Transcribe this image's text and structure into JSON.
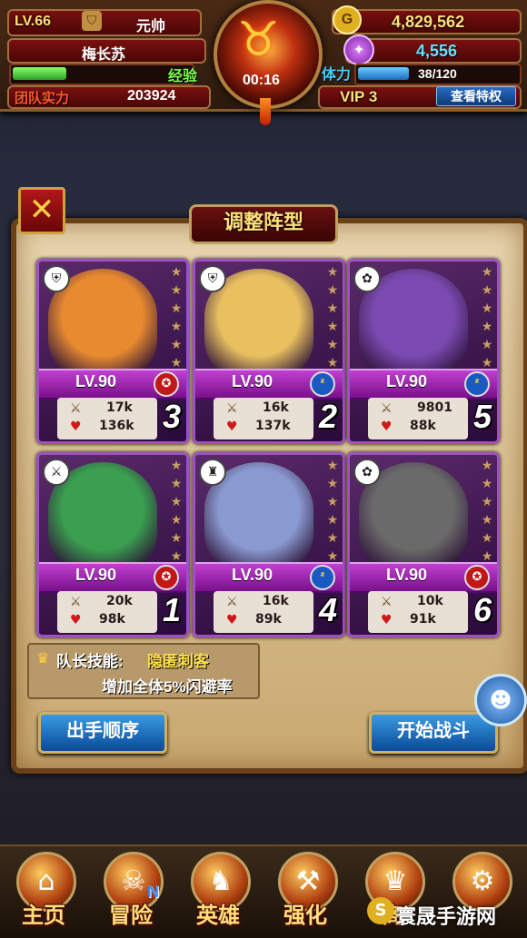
{
  "hud": {
    "level": "LV.66",
    "rank": "元帅",
    "player_name": "梅长苏",
    "exp_label": "经验",
    "exp_fill": 0.3,
    "power_label": "团队实力",
    "power_value": "203924",
    "timer": "00:16",
    "gold": "4,829,562",
    "gold_icon": "G",
    "gems": "4,556",
    "stamina_label": "体力",
    "stamina": "38/120",
    "stamina_fill": 0.3167,
    "vip": "VIP  3",
    "vip_button": "查看特权"
  },
  "panel": {
    "title": "调整阵型",
    "close": "✕"
  },
  "heroes": [
    {
      "class_icon": "shield-icon",
      "class_glyph": "⛨",
      "level": "LV.90",
      "faction": "red",
      "faction_glyph": "✪",
      "attack": "17k",
      "hp": "136k",
      "slot": "3",
      "color": "#e88a30"
    },
    {
      "class_icon": "shield-icon",
      "class_glyph": "⛨",
      "level": "LV.90",
      "faction": "blue",
      "faction_glyph": "ᶻ",
      "attack": "16k",
      "hp": "137k",
      "slot": "2",
      "color": "#e8c060"
    },
    {
      "class_icon": "paw-icon",
      "class_glyph": "✿",
      "level": "LV.90",
      "faction": "blue",
      "faction_glyph": "ᶻ",
      "attack": "9801",
      "hp": "88k",
      "slot": "5",
      "color": "#7a4ab0"
    },
    {
      "class_icon": "swords-icon",
      "class_glyph": "⚔",
      "level": "LV.90",
      "faction": "red",
      "faction_glyph": "✪",
      "attack": "20k",
      "hp": "98k",
      "slot": "1",
      "color": "#3aa050"
    },
    {
      "class_icon": "helmet-icon",
      "class_glyph": "♜",
      "level": "LV.90",
      "faction": "blue",
      "faction_glyph": "ᶻ",
      "attack": "16k",
      "hp": "89k",
      "slot": "4",
      "color": "#8a9ad0"
    },
    {
      "class_icon": "paw-icon",
      "class_glyph": "✿",
      "level": "LV.90",
      "faction": "red",
      "faction_glyph": "✪",
      "attack": "10k",
      "hp": "91k",
      "slot": "6",
      "color": "#6a6a6a"
    }
  ],
  "leader_skill": {
    "label": "队长技能:",
    "name": "隐匿刺客",
    "desc": "增加全体5%闪避率"
  },
  "buttons": {
    "order": "出手顺序",
    "start": "开始战斗"
  },
  "nav": [
    {
      "label": "主页",
      "icon": "home-icon",
      "glyph": "⌂"
    },
    {
      "label": "冒险",
      "icon": "skull-icon",
      "glyph": "☠",
      "badge": "N"
    },
    {
      "label": "英雄",
      "icon": "helmet-icon",
      "glyph": "♞"
    },
    {
      "label": "强化",
      "icon": "hammer-icon",
      "glyph": "⚒"
    },
    {
      "label": "商",
      "icon": "crown-icon",
      "glyph": "♛"
    },
    {
      "label": "",
      "icon": "gear-icon",
      "glyph": "⚙"
    }
  ],
  "watermark": {
    "text": "寰晟手游网",
    "logo": "S"
  },
  "colors": {
    "gold_text": "#ffe07a",
    "exp_green": "#4ad04a",
    "stamina_blue": "#3a9ae0",
    "card_purple": "#a050c0"
  }
}
